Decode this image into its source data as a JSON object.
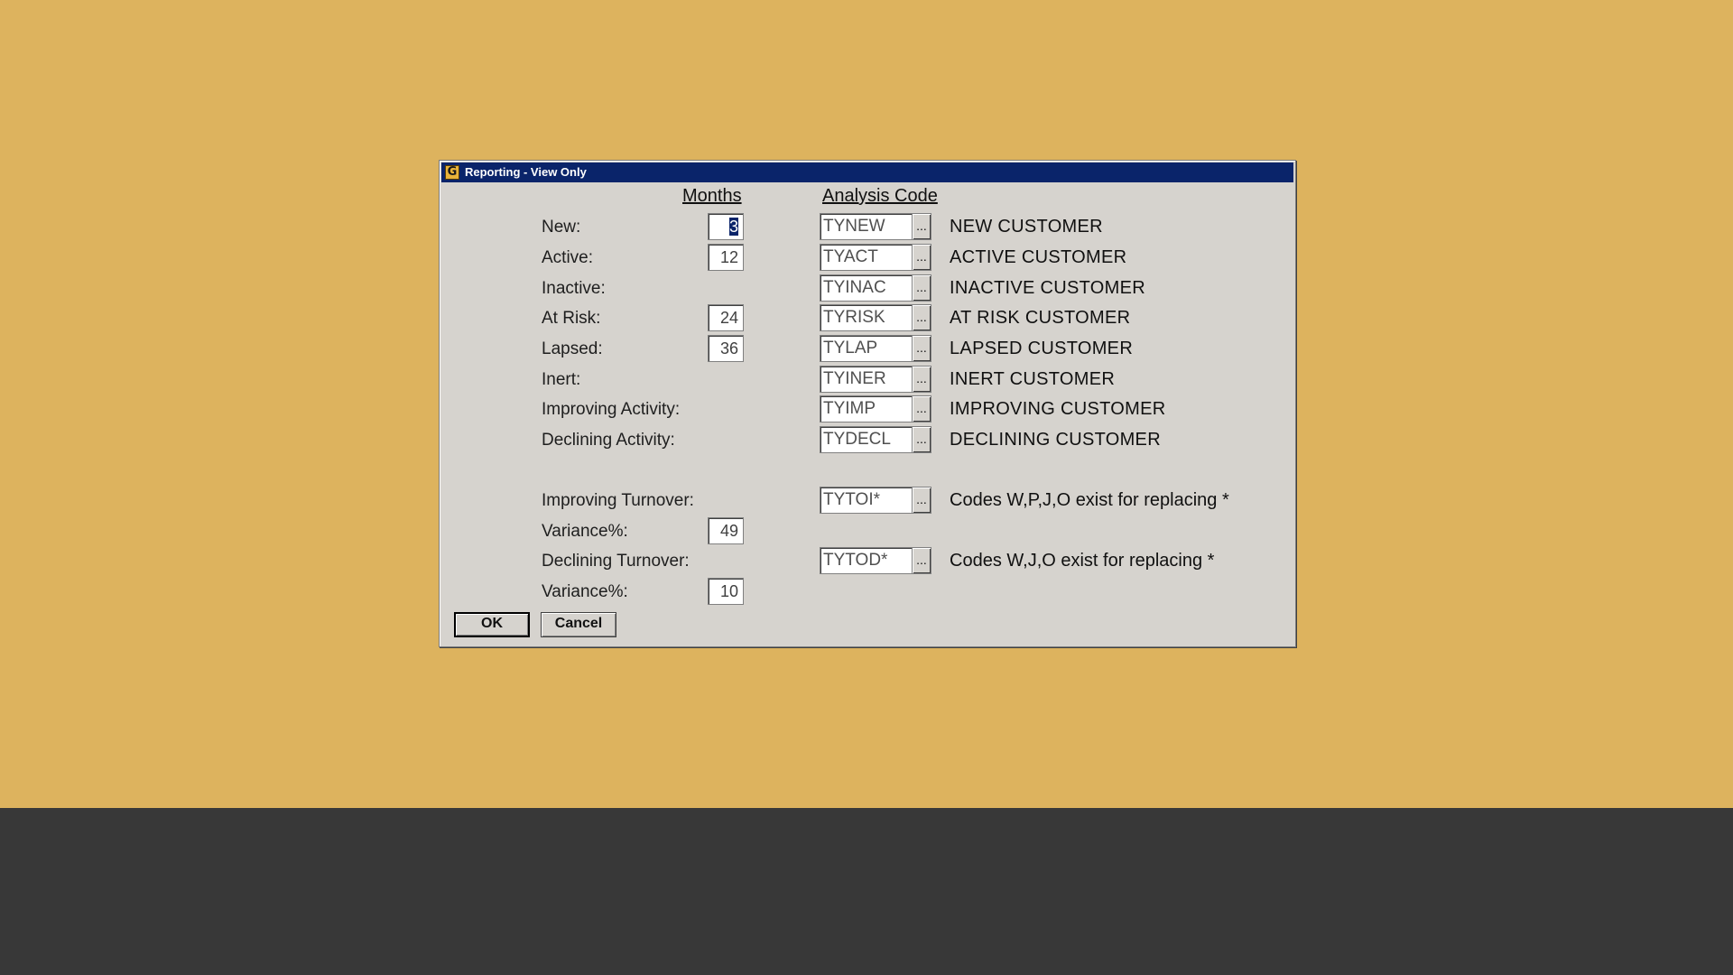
{
  "window": {
    "title": "Reporting - View Only",
    "icon": "G"
  },
  "headers": {
    "months": "Months",
    "analysis_code": "Analysis Code"
  },
  "rows": [
    {
      "label": "New:",
      "months": "3",
      "code": "TYNEW",
      "browse": "...",
      "desc": "NEW CUSTOMER"
    },
    {
      "label": "Active:",
      "months": "12",
      "code": "TYACT",
      "browse": "...",
      "desc": "ACTIVE CUSTOMER"
    },
    {
      "label": "Inactive:",
      "code": "TYINAC",
      "browse": "...",
      "desc": "INACTIVE CUSTOMER"
    },
    {
      "label": "At Risk:",
      "months": "24",
      "code": "TYRISK",
      "browse": "...",
      "desc": "AT RISK CUSTOMER"
    },
    {
      "label": "Lapsed:",
      "months": "36",
      "code": "TYLAP",
      "browse": "...",
      "desc": "LAPSED CUSTOMER"
    },
    {
      "label": "Inert:",
      "code": "TYINER",
      "browse": "...",
      "desc": "INERT CUSTOMER"
    },
    {
      "label": "Improving Activity:",
      "code": "TYIMP",
      "browse": "...",
      "desc": "IMPROVING CUSTOMER"
    },
    {
      "label": "Declining Activity:",
      "code": "TYDECL",
      "browse": "...",
      "desc": "DECLINING CUSTOMER"
    }
  ],
  "turnover": {
    "improving": {
      "label": "Improving Turnover:",
      "code": "TYTOI*",
      "browse": "...",
      "desc": "Codes W,P,J,O exist for replacing *"
    },
    "improving_variance": {
      "label": "Variance%:",
      "value": "49"
    },
    "declining": {
      "label": "Declining Turnover:",
      "code": "TYTOD*",
      "browse": "...",
      "desc": "Codes W,J,O exist for replacing *"
    },
    "declining_variance": {
      "label": "Variance%:",
      "value": "10"
    }
  },
  "buttons": {
    "ok": "OK",
    "cancel": "Cancel"
  },
  "colors": {
    "desktop": "#ddb35e",
    "taskbar": "#383838",
    "titlebar": "#0a246a",
    "dialog": "#d6d3ce"
  }
}
